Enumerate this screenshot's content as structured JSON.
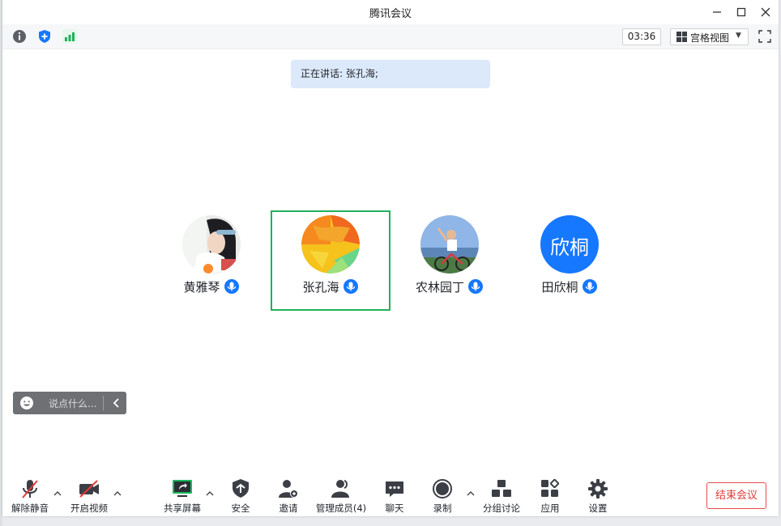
{
  "window": {
    "title": "腾讯会议"
  },
  "subbar": {
    "timer": "03:36",
    "view_label": "宫格视图"
  },
  "speaking": {
    "text": "正在讲话: 张孔海;"
  },
  "participants": [
    {
      "name": "黄雅琴",
      "avatar_type": "photo"
    },
    {
      "name": "张孔海",
      "avatar_type": "abstract",
      "active": true
    },
    {
      "name": "农林园丁",
      "avatar_type": "photo"
    },
    {
      "name": "田欣桐",
      "avatar_type": "text",
      "avatar_text": "欣桐"
    }
  ],
  "chat": {
    "placeholder": "说点什么..."
  },
  "toolbar": {
    "unmute": "解除静音",
    "video": "开启视频",
    "share": "共享屏幕",
    "security": "安全",
    "invite": "邀请",
    "members": "管理成员(4)",
    "chat": "聊天",
    "record": "录制",
    "breakout": "分组讨论",
    "apps": "应用",
    "settings": "设置",
    "end": "结束会议"
  },
  "colors": {
    "accent": "#1677ff",
    "active_border": "#20b05c",
    "danger": "#e23b3b"
  }
}
